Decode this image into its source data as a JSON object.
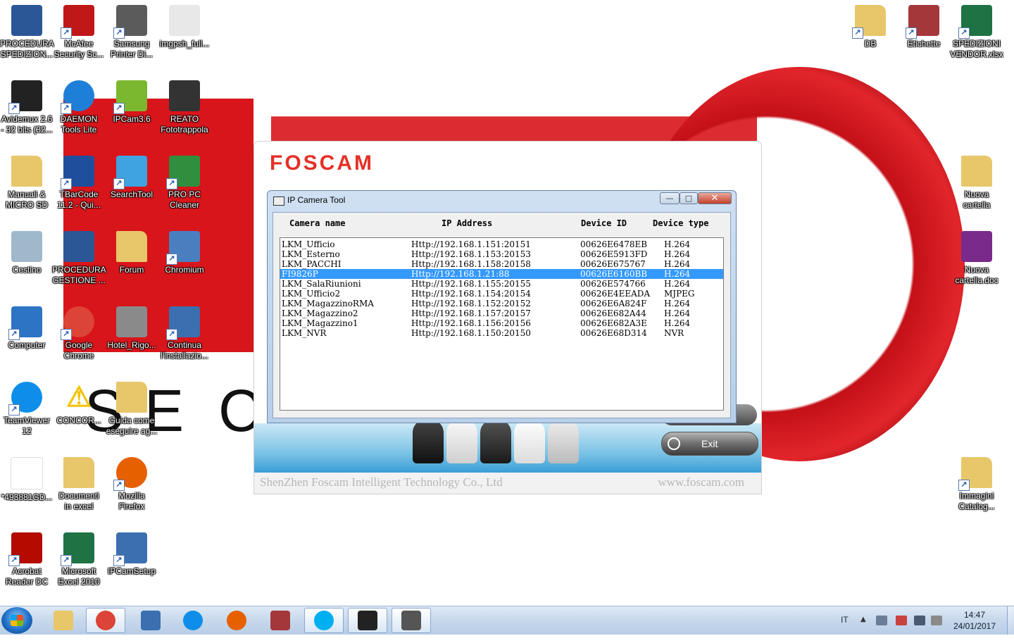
{
  "desktop": {
    "icons": [
      {
        "label": "PROCEDURA\nSPEDIZION...",
        "icon": "word-document-icon",
        "color": "#2b5797"
      },
      {
        "label": "McAfee\nSecurity Sc...",
        "icon": "mcafee-shield-icon",
        "color": "#c01818"
      },
      {
        "label": "Samsung\nPrinter Di...",
        "icon": "printer-icon",
        "color": "#5b5b5b"
      },
      {
        "label": "imgpsh_full...",
        "icon": "image-file-icon",
        "color": "#e8e8e8"
      },
      {
        "label": "Avidemux 2.6\n- 32 bits (32...",
        "icon": "clapperboard-icon",
        "color": "#222222"
      },
      {
        "label": "DAEMON\nTools Lite",
        "icon": "daemon-tools-icon",
        "color": "#1e7fd8"
      },
      {
        "label": "IPCam3.6",
        "icon": "ipcam-icon",
        "color": "#7cb82f"
      },
      {
        "label": "REATO\nFototrappola",
        "icon": "photo-thumbnail-icon",
        "color": "#333333"
      },
      {
        "label": "Manuali &\nMICRO SD",
        "icon": "folder-icon",
        "color": "#e8c76a"
      },
      {
        "label": "TBarCode\n11.2 - Qui...",
        "icon": "barcode-icon",
        "color": "#1f4f9c"
      },
      {
        "label": "SearchTool",
        "icon": "search-tool-icon",
        "color": "#3ea3e0"
      },
      {
        "label": "PRO PC\nCleaner",
        "icon": "pc-cleaner-icon",
        "color": "#2f8f3f"
      },
      {
        "label": "Cestino",
        "icon": "recycle-bin-icon",
        "color": "#9fb8cc"
      },
      {
        "label": "PROCEDURA\nGESTIONE ...",
        "icon": "word-document-icon",
        "color": "#2b5797"
      },
      {
        "label": "Forum",
        "icon": "folder-icon",
        "color": "#e8c76a"
      },
      {
        "label": "Chromium",
        "icon": "chromium-window-icon",
        "color": "#4a7fbf"
      },
      {
        "label": "Computer",
        "icon": "computer-icon",
        "color": "#2d74c4"
      },
      {
        "label": "Google\nChrome",
        "icon": "chrome-icon",
        "color": "#db4437"
      },
      {
        "label": "Hotel_Rigo...",
        "icon": "photo-thumbnail-icon",
        "color": "#8a8a8a"
      },
      {
        "label": "Continua\nl'installazio...",
        "icon": "installer-icon",
        "color": "#3b6fb0"
      },
      {
        "label": "TeamViewer\n12",
        "icon": "teamviewer-icon",
        "color": "#0e8ee9"
      },
      {
        "label": "CONCOR...",
        "icon": "warning-icon",
        "color": "#f2c200"
      },
      {
        "label": "Guida come\neseguire ag...",
        "icon": "folder-icon",
        "color": "#e8c76a"
      },
      {
        "label": "*493881GD...",
        "icon": "lkm-logo-icon",
        "color": "#ffffff"
      },
      {
        "label": "Documenti\nin excel",
        "icon": "folder-icon",
        "color": "#e8c76a"
      },
      {
        "label": "Mozilla\nFirefox",
        "icon": "firefox-icon",
        "color": "#e66000"
      },
      {
        "label": "Acrobat\nReader DC",
        "icon": "acrobat-icon",
        "color": "#b30b00"
      },
      {
        "label": "Microsoft\nExcel 2010",
        "icon": "excel-icon",
        "color": "#1f7244"
      },
      {
        "label": "IPCamSetup",
        "icon": "installer-icon",
        "color": "#3b6fb0"
      },
      {
        "label": "DB",
        "icon": "folder-icon",
        "color": "#e8c76a"
      },
      {
        "label": "Etichette",
        "icon": "access-document-icon",
        "color": "#a4373a"
      },
      {
        "label": "SPEDIZIONI\nVENDOR.xlsx",
        "icon": "excel-icon",
        "color": "#1f7244"
      },
      {
        "label": "Nuova\ncartella",
        "icon": "folder-icon",
        "color": "#e8c76a"
      },
      {
        "label": "Nuova\ncartella.doc",
        "icon": "winrar-icon",
        "color": "#7a2a8a"
      },
      {
        "label": "Immagini\nCatalog...",
        "icon": "folder-icon",
        "color": "#e8c76a"
      }
    ],
    "wallpaper_letters": [
      "S",
      "E",
      "C"
    ]
  },
  "foscam": {
    "logo": "FOSCAM",
    "company": "ShenZhen Foscam Intelligent Technology Co., Ltd",
    "url": "www.foscam.com",
    "exit_label": "Exit",
    "brand_color": "#e63027"
  },
  "ipwindow": {
    "title": "IP Camera Tool",
    "columns": [
      "Camera name",
      "IP Address",
      "Device ID",
      "Device type"
    ],
    "selected_index": 3,
    "rows": [
      {
        "name": "LKM_Ufficio",
        "ip": "Http://192.168.1.151:20151",
        "id": "00626E6478EB",
        "type": "H.264"
      },
      {
        "name": "LKM_Esterno",
        "ip": "Http://192.168.1.153:20153",
        "id": "00626E5913FD",
        "type": "H.264"
      },
      {
        "name": "LKM_PACCHI",
        "ip": "Http://192.168.1.158:20158",
        "id": "00626E675767",
        "type": "H.264"
      },
      {
        "name": "FI9826P",
        "ip": "Http://192.168.1.21:88",
        "id": "00626E6160BB",
        "type": "H.264"
      },
      {
        "name": "LKM_SalaRiunioni",
        "ip": "Http://192.168.1.155:20155",
        "id": "00626E574766",
        "type": "H.264"
      },
      {
        "name": "LKM_Ufficio2",
        "ip": "Http://192.168.1.154:20154",
        "id": "00626E4EEADA",
        "type": "MJPEG"
      },
      {
        "name": "LKM_MagazzinoRMA",
        "ip": "Http://192.168.1.152:20152",
        "id": "00626E6A824F",
        "type": "H.264"
      },
      {
        "name": "LKM_Magazzino2",
        "ip": "Http://192.168.1.157:20157",
        "id": "00626E682A44",
        "type": "H.264"
      },
      {
        "name": "LKM_Magazzino1",
        "ip": "Http://192.168.1.156:20156",
        "id": "00626E682A3E",
        "type": "H.264"
      },
      {
        "name": "LKM_NVR",
        "ip": "Http://192.168.1.150:20150",
        "id": "00626E68D314",
        "type": "NVR"
      }
    ]
  },
  "taskbar": {
    "items": [
      {
        "icon": "explorer-folder-icon",
        "color": "#e8c76a",
        "active": false
      },
      {
        "icon": "chrome-icon",
        "color": "#db4437",
        "active": true
      },
      {
        "icon": "network-computer-icon",
        "color": "#3b6fb0",
        "active": false
      },
      {
        "icon": "teamviewer-icon",
        "color": "#0e8ee9",
        "active": false
      },
      {
        "icon": "firefox-icon",
        "color": "#e66000",
        "active": false
      },
      {
        "icon": "access-icon",
        "color": "#a4373a",
        "active": false
      },
      {
        "icon": "skype-icon",
        "color": "#00aff0",
        "active": true
      },
      {
        "icon": "foscam-camera-icon",
        "color": "#222222",
        "active": true
      },
      {
        "icon": "ip-camera-tool-icon",
        "color": "#555555",
        "active": true
      }
    ],
    "language": "IT",
    "time": "14:47",
    "date": "24/01/2017"
  }
}
